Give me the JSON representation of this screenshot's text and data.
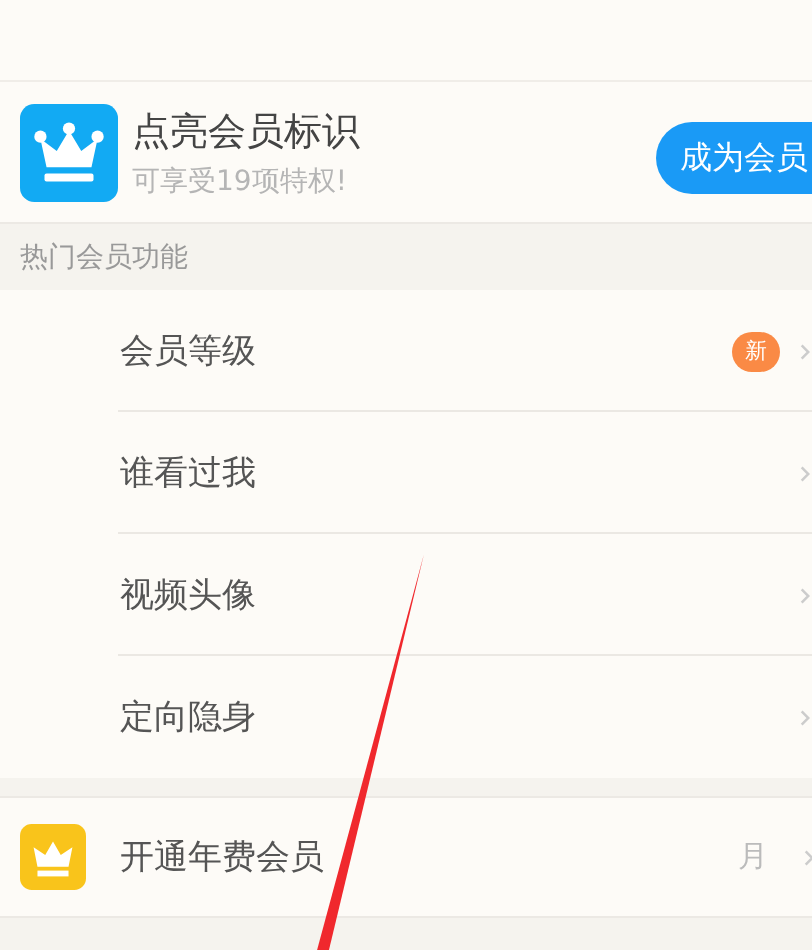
{
  "member_card": {
    "title": "点亮会员标识",
    "subtitle": "可享受19项特权!",
    "button": "成为会员"
  },
  "section_header": "热门会员功能",
  "features": [
    {
      "label": "会员等级",
      "badge": "新"
    },
    {
      "label": "谁看过我"
    },
    {
      "label": "视频头像"
    },
    {
      "label": "定向隐身"
    }
  ],
  "annual_row": {
    "label": "开通年费会员",
    "value": "月"
  }
}
